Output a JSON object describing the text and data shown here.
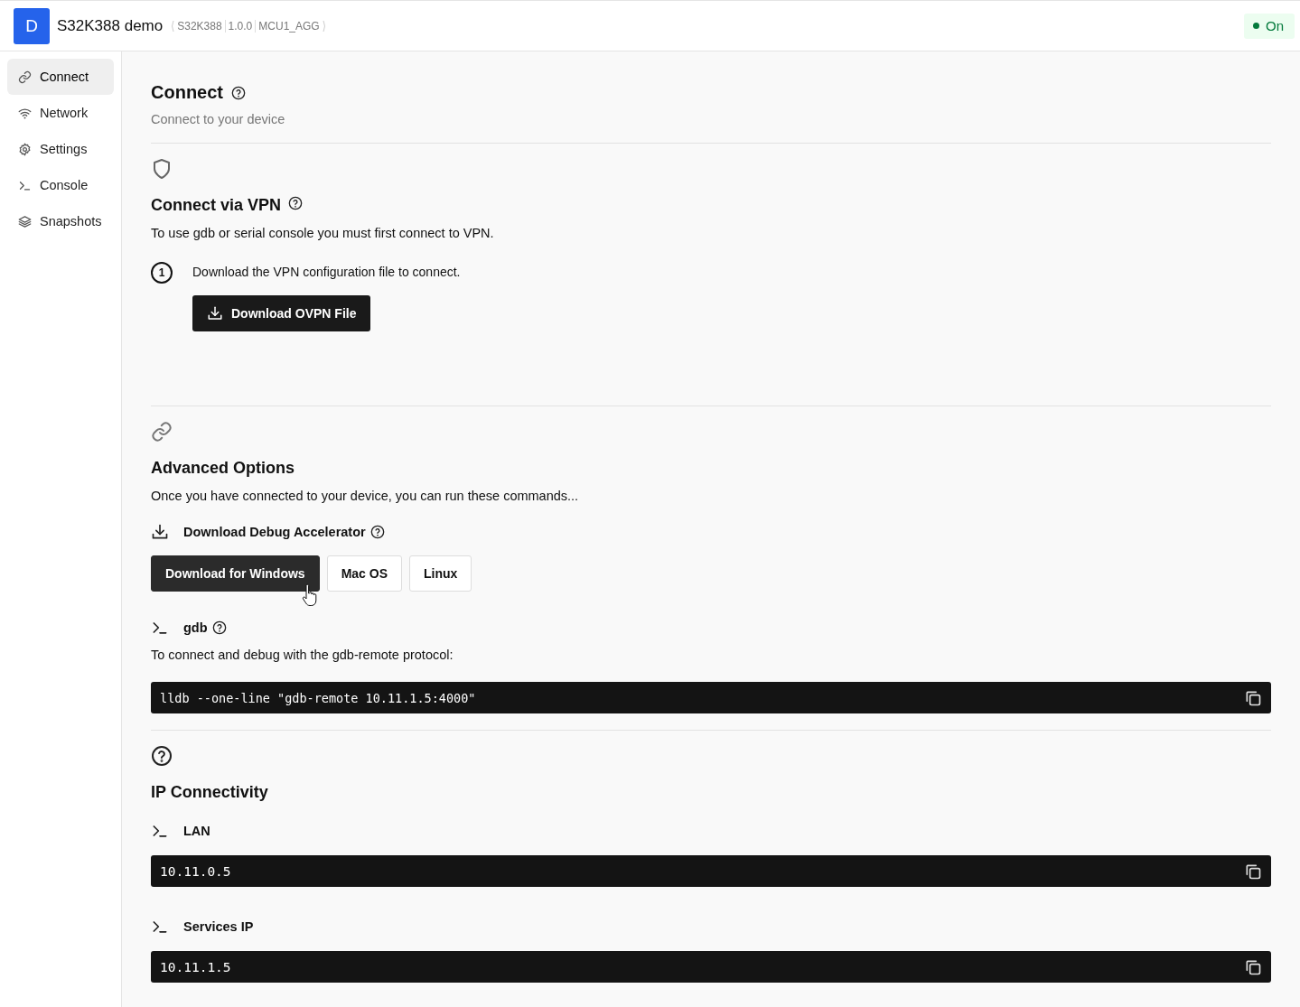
{
  "header": {
    "logo": "D",
    "title": "S32K388 demo",
    "tags": [
      "S32K388",
      "1.0.0",
      "MCU1_AGG"
    ],
    "status": {
      "label": "On",
      "on": true
    }
  },
  "sidebar": {
    "items": [
      {
        "label": "Connect",
        "selected": true
      },
      {
        "label": "Network",
        "selected": false
      },
      {
        "label": "Settings",
        "selected": false
      },
      {
        "label": "Console",
        "selected": false
      },
      {
        "label": "Snapshots",
        "selected": false
      }
    ]
  },
  "page": {
    "title": "Connect",
    "help": true,
    "subtitle": "Connect to your device"
  },
  "sections": [
    {
      "kind": "vpn",
      "title": "Connect via VPN",
      "help": true,
      "description": "To use gdb or serial console you must first connect to VPN.",
      "steps": [
        {
          "number": "1",
          "text": "Download the VPN configuration file to connect.",
          "button": "Download OVPN File"
        }
      ]
    },
    {
      "kind": "advanced",
      "title": "Advanced Options",
      "help": false,
      "description": "Once you have connected to your device, you can run these commands...",
      "download": {
        "label": "Download Debug Accelerator",
        "help": true,
        "buttons": [
          {
            "label": "Download for Windows",
            "primary": true
          },
          {
            "label": "Mac OS",
            "primary": false
          },
          {
            "label": "Linux",
            "primary": false
          }
        ]
      },
      "gdb": {
        "label": "gdb",
        "help": true,
        "description": "To connect and debug with the gdb-remote protocol:",
        "command": "lldb --one-line \"gdb-remote 10.11.1.5:4000\""
      }
    },
    {
      "kind": "ip",
      "title": "IP Connectivity",
      "help": false,
      "entries": [
        {
          "label": "LAN",
          "value": "10.11.0.5"
        },
        {
          "label": "Services IP",
          "value": "10.11.1.5"
        }
      ]
    }
  ]
}
